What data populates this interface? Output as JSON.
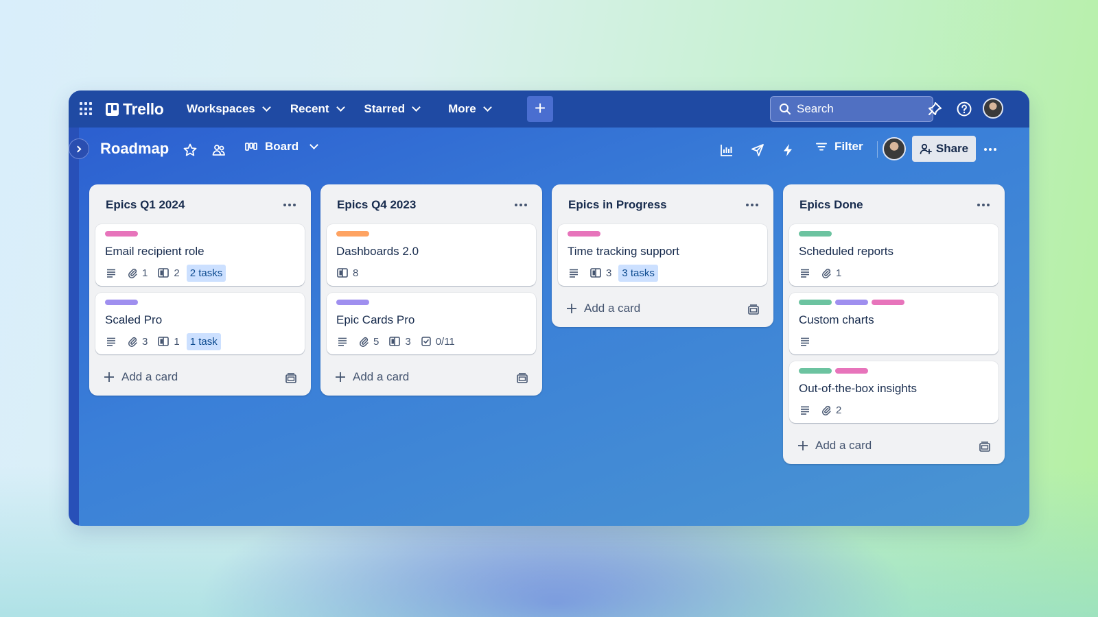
{
  "app": {
    "name": "Trello"
  },
  "nav": {
    "items": [
      {
        "label": "Workspaces"
      },
      {
        "label": "Recent"
      },
      {
        "label": "Starred"
      },
      {
        "label": "More"
      }
    ],
    "create_label": "+"
  },
  "search": {
    "placeholder": "Search"
  },
  "board": {
    "title": "Roadmap",
    "view_label": "Board",
    "filter_label": "Filter",
    "share_label": "Share"
  },
  "colors": {
    "pink": "#e774bb",
    "orange": "#fea362",
    "purple": "#9f8fef",
    "green": "#6cc3a0",
    "task_badge_bg": "#cce0ff"
  },
  "lists": [
    {
      "title": "Epics Q1 2024",
      "add_label": "Add a card",
      "cards": [
        {
          "title": "Email recipient role",
          "labels": [
            "#e774bb"
          ],
          "description": true,
          "attachments": "1",
          "boards": "2",
          "tasks": "2 tasks"
        },
        {
          "title": "Scaled Pro",
          "labels": [
            "#9f8fef"
          ],
          "description": true,
          "attachments": "3",
          "boards": "1",
          "tasks": "1 task"
        }
      ]
    },
    {
      "title": "Epics Q4 2023",
      "add_label": "Add a card",
      "cards": [
        {
          "title": "Dashboards 2.0",
          "labels": [
            "#fea362"
          ],
          "boards": "8"
        },
        {
          "title": "Epic Cards Pro",
          "labels": [
            "#9f8fef"
          ],
          "description": true,
          "attachments": "5",
          "boards": "3",
          "checklist": "0/11"
        }
      ]
    },
    {
      "title": "Epics in Progress",
      "add_label": "Add a card",
      "cards": [
        {
          "title": "Time tracking support",
          "labels": [
            "#e774bb"
          ],
          "description": true,
          "boards": "3",
          "tasks": "3 tasks"
        }
      ]
    },
    {
      "title": "Epics Done",
      "add_label": "Add a card",
      "cards": [
        {
          "title": "Scheduled reports",
          "labels": [
            "#6cc3a0"
          ],
          "description": true,
          "attachments": "1"
        },
        {
          "title": "Custom charts",
          "labels": [
            "#6cc3a0",
            "#9f8fef",
            "#e774bb"
          ],
          "description": true
        },
        {
          "title": "Out-of-the-box insights",
          "labels": [
            "#6cc3a0",
            "#e774bb"
          ],
          "description": true,
          "attachments": "2"
        }
      ]
    }
  ]
}
